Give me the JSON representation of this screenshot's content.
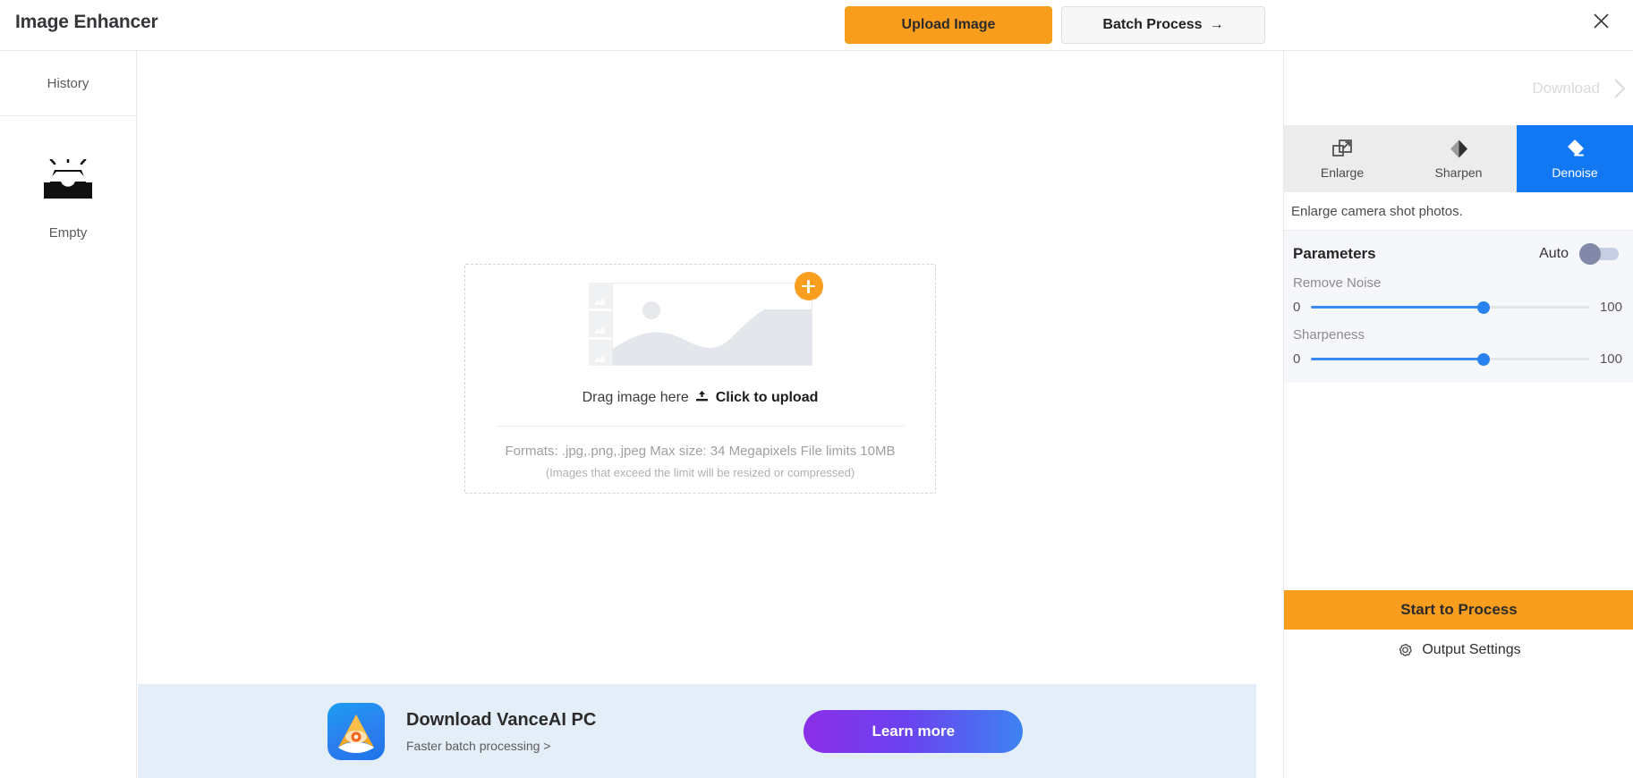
{
  "header": {
    "title": "Image Enhancer",
    "upload_label": "Upload Image",
    "batch_label": "Batch Process",
    "batch_arrow": "→",
    "close_icon": "close-icon"
  },
  "sidebar": {
    "history_label": "History",
    "empty_label": "Empty",
    "empty_icon": "inbox-empty-icon"
  },
  "canvas": {
    "dropzone": {
      "drag_text": "Drag image here",
      "click_text": "Click to upload",
      "upload_icon": "upload-icon",
      "plus_icon": "plus-icon",
      "formats": "Formats: .jpg,.png,.jpeg Max size: 34 Megapixels File limits 10MB",
      "note": "(Images that exceed the limit will be resized or compressed)"
    }
  },
  "banner": {
    "logo_icon": "vanceai-logo-icon",
    "title": "Download VanceAI PC",
    "subtitle": "Faster batch processing >",
    "cta_label": "Learn more"
  },
  "panel": {
    "download_label": "Download",
    "download_chevron_icon": "chevron-right-icon",
    "tabs": [
      {
        "label": "Enlarge",
        "icon": "enlarge-icon",
        "active": false
      },
      {
        "label": "Sharpen",
        "icon": "sharpen-icon",
        "active": false
      },
      {
        "label": "Denoise",
        "icon": "denoise-eraser-icon",
        "active": true
      }
    ],
    "tab_description": "Enlarge camera shot photos.",
    "parameters": {
      "title": "Parameters",
      "auto_label": "Auto",
      "auto_enabled": false,
      "sliders": [
        {
          "label": "Remove Noise",
          "min": "0",
          "max": "100",
          "percent": 62
        },
        {
          "label": "Sharpeness",
          "min": "0",
          "max": "100",
          "percent": 62
        }
      ]
    },
    "process_label": "Start to Process",
    "output_settings_label": "Output Settings",
    "output_settings_icon": "gear-icon"
  },
  "colors": {
    "accent_orange": "#f99d1e",
    "active_blue": "#1277f2",
    "slider_blue": "#2a82f0",
    "banner_bg": "#e3eef8"
  }
}
